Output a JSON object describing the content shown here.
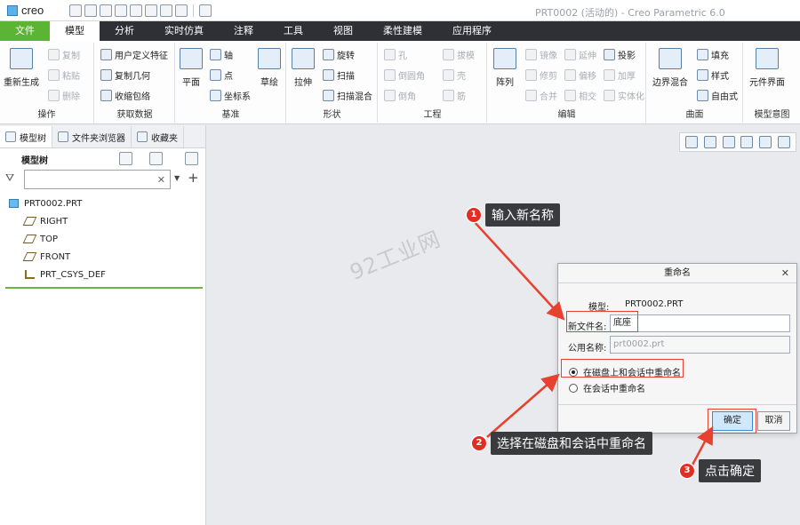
{
  "app": {
    "logo": "creo",
    "window_title": "PRT0002 (活动的) - Creo Parametric 6.0"
  },
  "tabs": [
    "文件",
    "模型",
    "分析",
    "实时仿真",
    "注释",
    "工具",
    "视图",
    "柔性建模",
    "应用程序"
  ],
  "ribbon": {
    "operations": {
      "label": "操作",
      "regen": "重新生成",
      "copy": "复制",
      "paste": "粘贴",
      "delete": "删除"
    },
    "get_data": {
      "label": "获取数据",
      "udf": "用户定义特征",
      "copy_geom": "复制几何",
      "shrinkwrap": "收缩包络"
    },
    "datum": {
      "label": "基准",
      "plane": "平面",
      "axis": "轴",
      "point": "点",
      "csys": "坐标系",
      "sketch": "草绘"
    },
    "shapes": {
      "label": "形状",
      "extrude": "拉伸",
      "revolve": "旋转",
      "sweep": "扫描",
      "swept_blend": "扫描混合"
    },
    "engineering": {
      "label": "工程",
      "hole": "孔",
      "round": "倒圆角",
      "chamfer": "倒角",
      "draft": "拔模",
      "shell": "壳",
      "rib": "筋"
    },
    "editing": {
      "label": "编辑",
      "pattern": "阵列",
      "mirror": "镜像",
      "trim": "修剪",
      "merge": "合并",
      "extend": "延伸",
      "offset": "偏移",
      "intersect": "相交",
      "project": "投影",
      "thicken": "加厚",
      "solidify": "实体化"
    },
    "surfaces": {
      "label": "曲面",
      "boundary_blend": "边界混合",
      "fill": "填充",
      "style": "样式",
      "freestyle": "自由式"
    },
    "model_intent": {
      "label": "模型意图",
      "component_interface": "元件界面"
    }
  },
  "left_panel": {
    "tabs": [
      "模型树",
      "文件夹浏览器",
      "收藏夹"
    ],
    "header": "模型树",
    "search_value": "",
    "tree": [
      {
        "label": "PRT0002.PRT",
        "icon": "part-icon"
      },
      {
        "label": "RIGHT",
        "icon": "datum-plane-icon"
      },
      {
        "label": "TOP",
        "icon": "datum-plane-icon"
      },
      {
        "label": "FRONT",
        "icon": "datum-plane-icon"
      },
      {
        "label": "PRT_CSYS_DEF",
        "icon": "csys-icon"
      }
    ]
  },
  "watermark": "92工业网",
  "dialog": {
    "title": "重命名",
    "model_label": "模型:",
    "model_value": "PRT0002.PRT",
    "new_name_label": "新文件名:",
    "new_name_value": "底座",
    "common_name_label": "公用名称:",
    "common_name_value": "prt0002.prt",
    "option_disk_session": "在磁盘上和会话中重命名",
    "option_session": "在会话中重命名",
    "ok": "确定",
    "cancel": "取消"
  },
  "callouts": [
    {
      "num": "1",
      "text": "输入新名称"
    },
    {
      "num": "2",
      "text": "选择在磁盘和会话中重命名"
    },
    {
      "num": "3",
      "text": "点击确定"
    }
  ],
  "colors": {
    "accent_red": "#e8412f",
    "file_tab_green": "#5bb434",
    "tab_bar_dark": "#2e3035"
  }
}
